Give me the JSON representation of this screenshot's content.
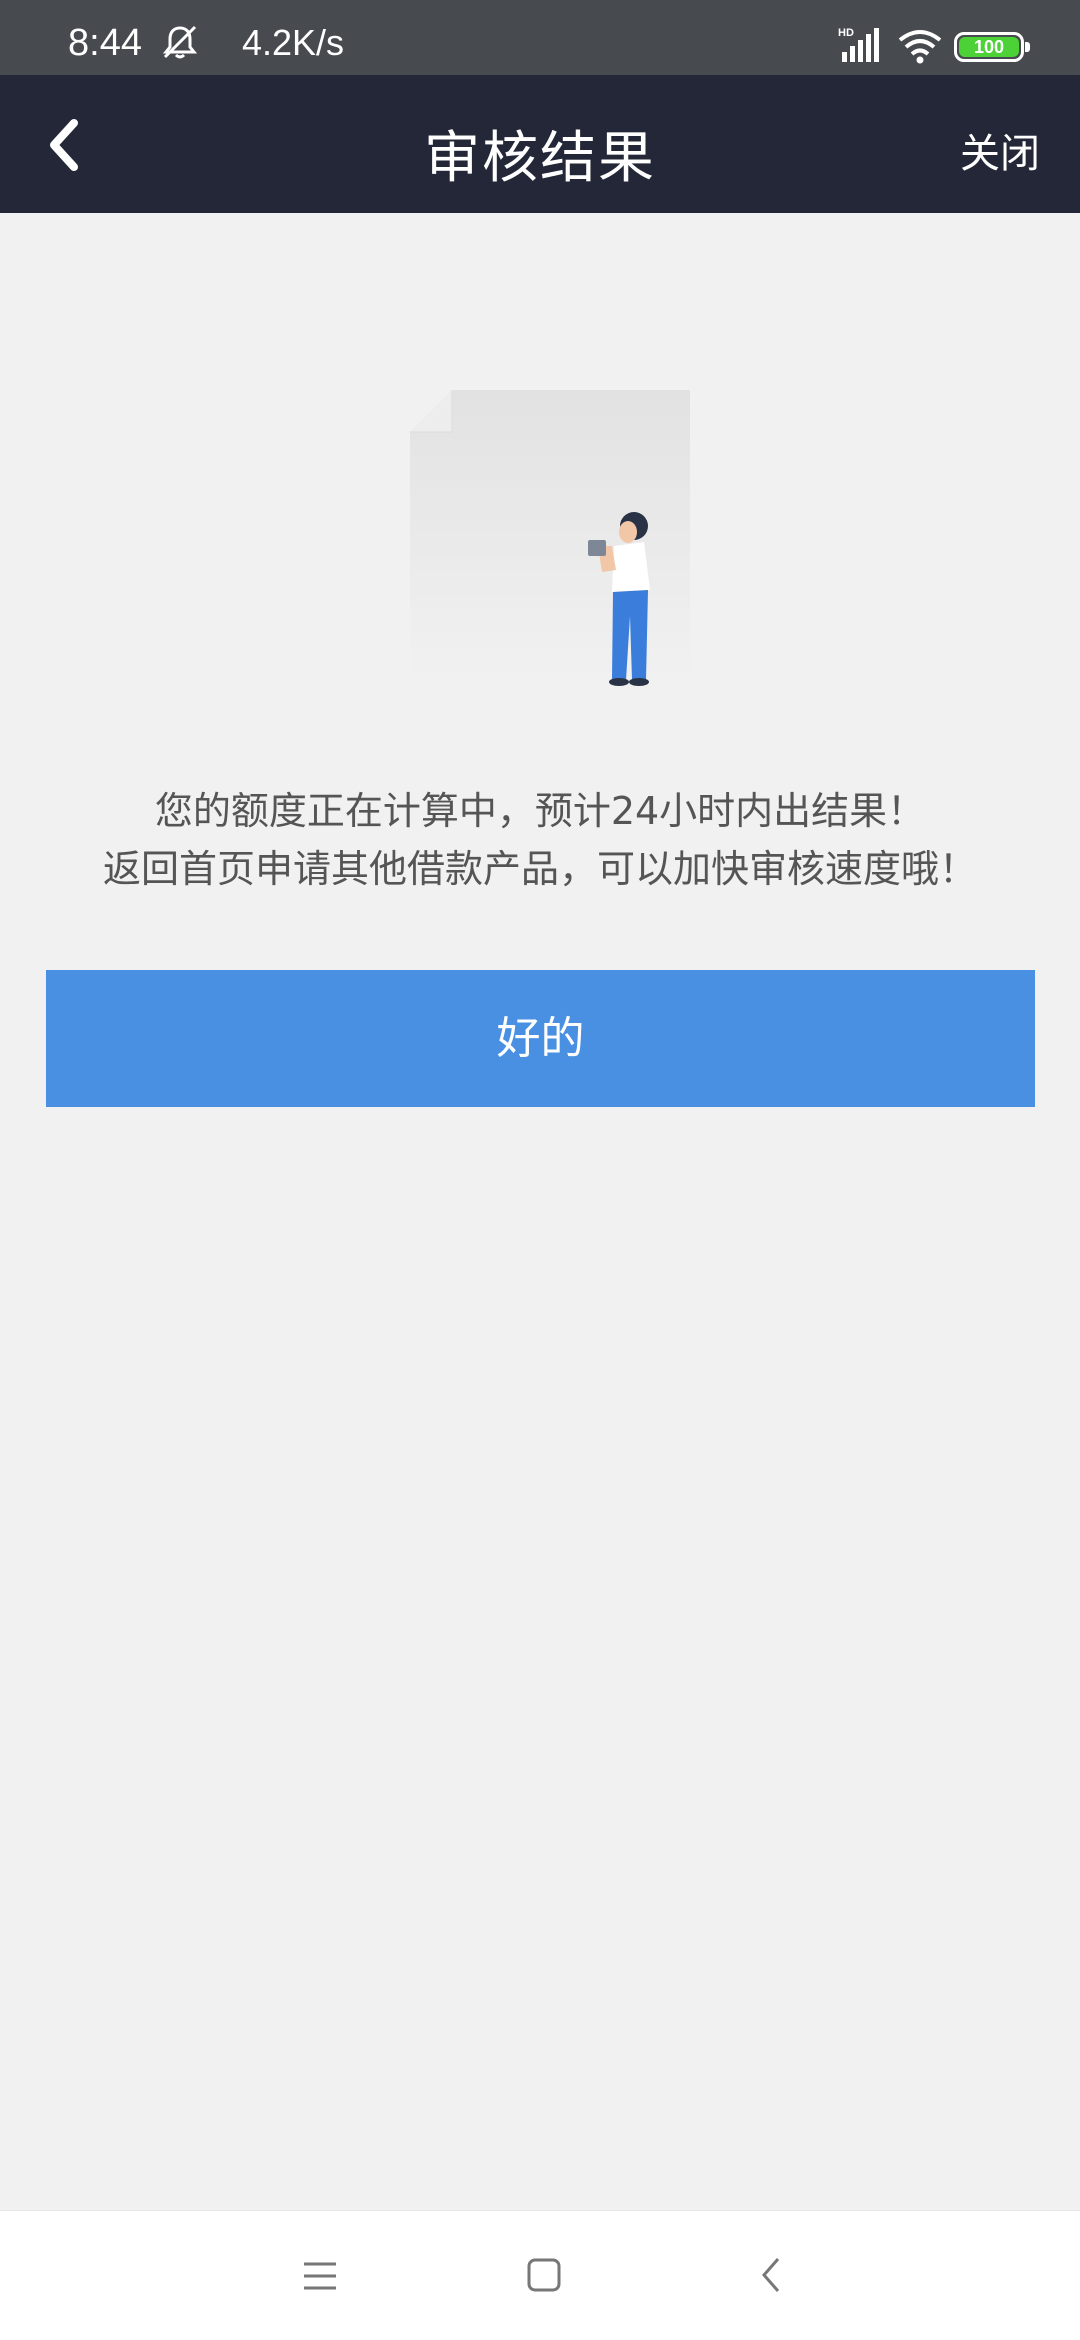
{
  "status_bar": {
    "time": "8:44",
    "speed": "4.2K/s",
    "network_label": "HD",
    "battery": "100",
    "icons": [
      "mute-bell-icon",
      "signal-icon",
      "wifi-icon",
      "battery-icon"
    ]
  },
  "header": {
    "title": "审核结果",
    "close_label": "关闭",
    "back_icon": "chevron-left-icon"
  },
  "main": {
    "illustration": "document-with-person-illustration",
    "message_line1": "您的额度正在计算中，预计24小时内出结果！",
    "message_line2": "返回首页申请其他借款产品，可以加快审核速度哦！",
    "ok_button_label": "好的"
  },
  "nav_bar": {
    "icons": [
      "menu-icon",
      "home-icon",
      "back-icon"
    ]
  },
  "colors": {
    "status_bar_bg": "#474a4f",
    "header_bg": "#232737",
    "page_bg": "#f1f1f1",
    "button_bg": "#4a90e2",
    "battery_green": "#4cd137"
  }
}
